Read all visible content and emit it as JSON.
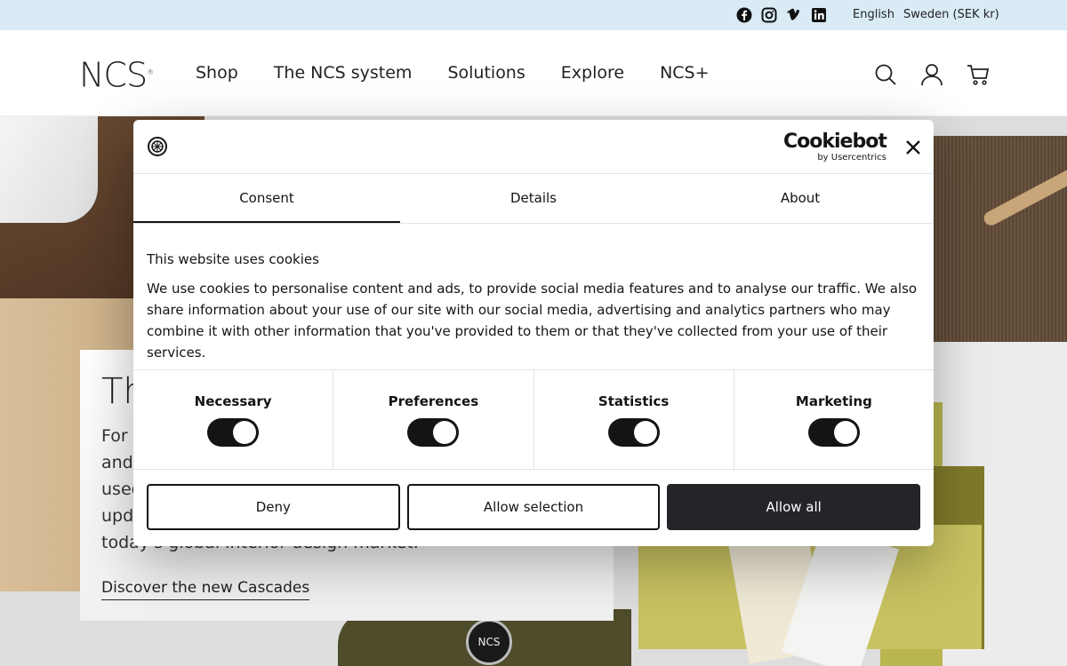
{
  "topbar": {
    "social_icons": [
      "facebook-icon",
      "instagram-icon",
      "vimeo-icon",
      "linkedin-icon"
    ],
    "language": "English",
    "region": "Sweden (SEK kr)"
  },
  "header": {
    "logo": "NCS",
    "logo_mark": "®",
    "nav": [
      "Shop",
      "The NCS system",
      "Solutions",
      "Explore",
      "NCS+"
    ],
    "icons": [
      "search-icon",
      "account-icon",
      "cart-icon"
    ]
  },
  "hero": {
    "title": "Th",
    "body_lines": [
      "For c",
      "and",
      "used",
      "upd",
      "today's global interior design market."
    ],
    "link": "Discover the new Cascades",
    "puck_label": "NCS"
  },
  "cookie_dialog": {
    "brand_name": "Cookiebot",
    "brand_sub": "by Usercentrics",
    "tabs": [
      "Consent",
      "Details",
      "About"
    ],
    "active_tab": "Consent",
    "heading": "This website uses cookies",
    "text": "We use cookies to personalise content and ads, to provide social media features and to analyse our traffic. We also share information about your use of our site with our social media, advertising and analytics partners who may combine it with other information that you've provided to them or that they've collected from your use of their services.",
    "categories": [
      {
        "label": "Necessary",
        "enabled": true
      },
      {
        "label": "Preferences",
        "enabled": true
      },
      {
        "label": "Statistics",
        "enabled": true
      },
      {
        "label": "Marketing",
        "enabled": true
      }
    ],
    "buttons": {
      "deny": "Deny",
      "allow_selection": "Allow selection",
      "allow_all": "Allow all"
    }
  },
  "colors": {
    "topbar_bg": "#d9ebf5",
    "dark": "#232529",
    "text": "#141414"
  }
}
